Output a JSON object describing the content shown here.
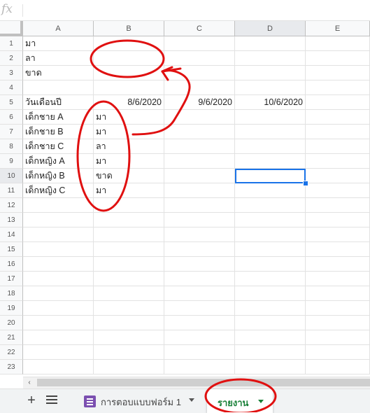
{
  "formula_bar": {
    "fx_label": "fx",
    "value": ""
  },
  "columns": [
    "A",
    "B",
    "C",
    "D",
    "E"
  ],
  "rows": [
    "1",
    "2",
    "3",
    "4",
    "5",
    "6",
    "7",
    "8",
    "9",
    "10",
    "11",
    "12",
    "13",
    "14",
    "15",
    "16",
    "17",
    "18",
    "19",
    "20",
    "21",
    "22",
    "23"
  ],
  "cells": {
    "A1": "มา",
    "A2": "ลา",
    "A3": "ขาด",
    "A5": "วันเดือนปี",
    "B5": "8/6/2020",
    "C5": "9/6/2020",
    "D5": "10/6/2020",
    "A6": "เด็กชาย A",
    "A7": "เด็กชาย B",
    "A8": "เด็กชาย C",
    "A9": "เด็กหญิง A",
    "A10": "เด็กหญิง B",
    "A11": "เด็กหญิง C",
    "B6": "มา",
    "B7": "มา",
    "B8": "ลา",
    "B9": "มา",
    "B10": "ขาด",
    "B11": "มา"
  },
  "selected_cell": "D10",
  "sheet_tabs": [
    {
      "label": "การตอบแบบฟอร์ม 1",
      "active": false
    },
    {
      "label": "รายงาน",
      "active": true
    }
  ],
  "colors": {
    "selection": "#1a73e8",
    "annotation": "#e01010",
    "active_tab": "#188038",
    "forms_icon": "#7b4fb0"
  },
  "icons": {
    "add_sheet": "plus-icon",
    "all_sheets": "menu-list-icon",
    "scroll_left": "chevron-left-icon"
  }
}
